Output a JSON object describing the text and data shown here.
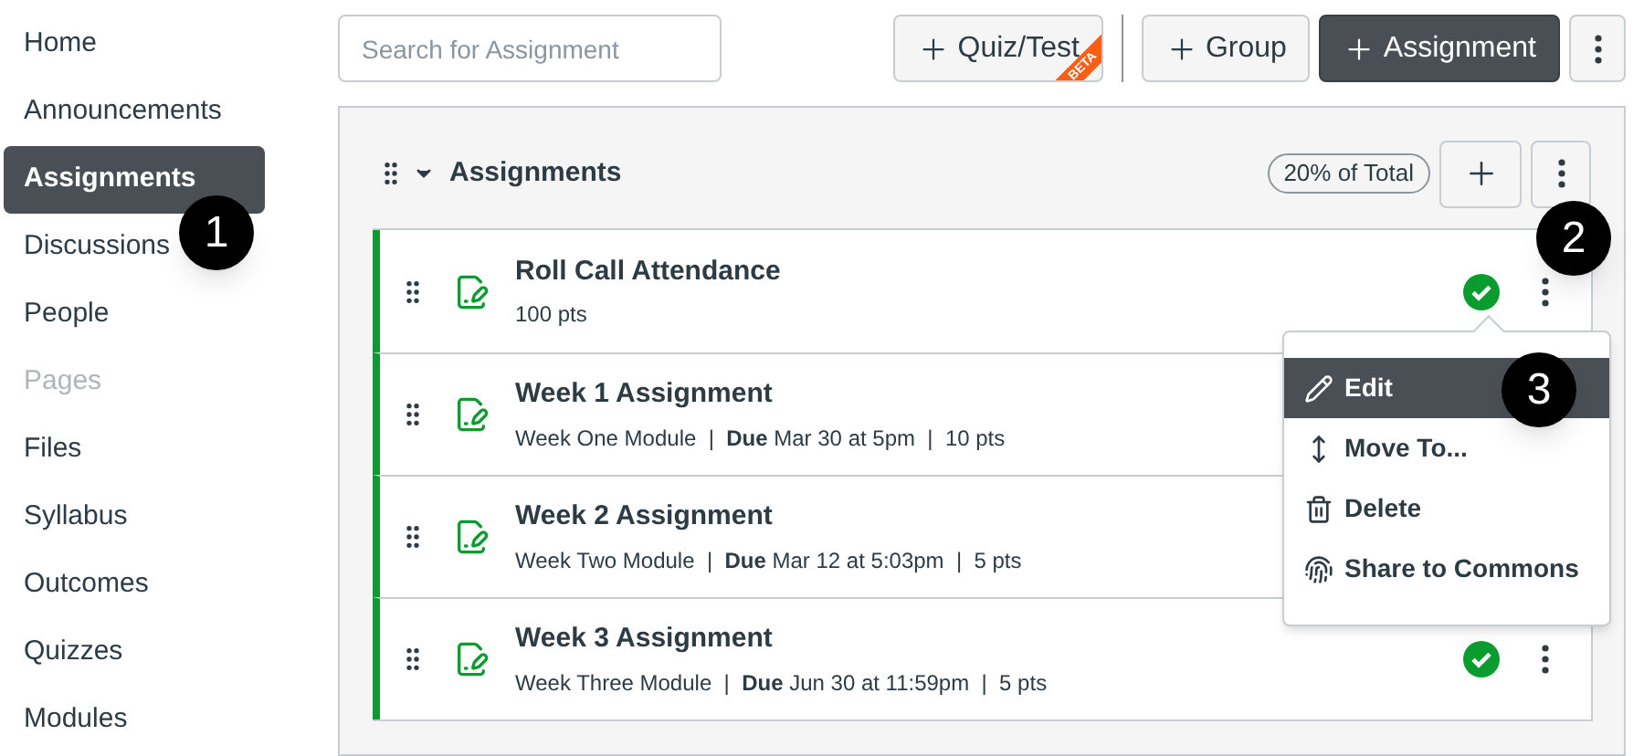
{
  "sidebar": {
    "items": [
      {
        "label": "Home",
        "selected": false,
        "disabled": false
      },
      {
        "label": "Announcements",
        "selected": false,
        "disabled": false
      },
      {
        "label": "Assignments",
        "selected": true,
        "disabled": false
      },
      {
        "label": "Discussions",
        "selected": false,
        "disabled": false
      },
      {
        "label": "People",
        "selected": false,
        "disabled": false
      },
      {
        "label": "Pages",
        "selected": false,
        "disabled": true
      },
      {
        "label": "Files",
        "selected": false,
        "disabled": false
      },
      {
        "label": "Syllabus",
        "selected": false,
        "disabled": false
      },
      {
        "label": "Outcomes",
        "selected": false,
        "disabled": false
      },
      {
        "label": "Quizzes",
        "selected": false,
        "disabled": false
      },
      {
        "label": "Modules",
        "selected": false,
        "disabled": false
      }
    ]
  },
  "toolbar": {
    "search": {
      "placeholder": "Search for Assignment"
    },
    "buttons": [
      {
        "kind": "beta",
        "label": "Quiz/Test",
        "badge": "BETA"
      },
      {
        "kind": "plain",
        "label": "Group"
      },
      {
        "kind": "primary",
        "label": "Assignment"
      },
      {
        "kind": "more"
      }
    ]
  },
  "group": {
    "title": "Assignments",
    "expanded": true,
    "weight": "20% of Total",
    "rows": [
      {
        "title": "Roll Call Attendance",
        "meta": "100 pts",
        "published": true
      },
      {
        "title": "Week 1 Assignment",
        "meta": "Week One Module  |  **Due** Mar 30 at 5pm  |  10 pts"
      },
      {
        "title": "Week 2 Assignment",
        "meta": "Week Two Module  |  **Due** Mar 12 at 5:03pm  |  5 pts"
      },
      {
        "title": "Week 3 Assignment",
        "meta": "Week Three Module  |  **Due** Jun 30 at 11:59pm  |  5 pts",
        "published": true
      }
    ]
  },
  "menu": {
    "items": [
      {
        "kind": "edit",
        "label": "Edit",
        "selected": true
      },
      {
        "kind": "move",
        "label": "Move To...",
        "selected": false
      },
      {
        "kind": "delete",
        "label": "Delete",
        "selected": false
      },
      {
        "kind": "share",
        "label": "Share to Commons",
        "selected": false
      }
    ]
  },
  "callouts": [
    "1",
    "2",
    "3"
  ]
}
